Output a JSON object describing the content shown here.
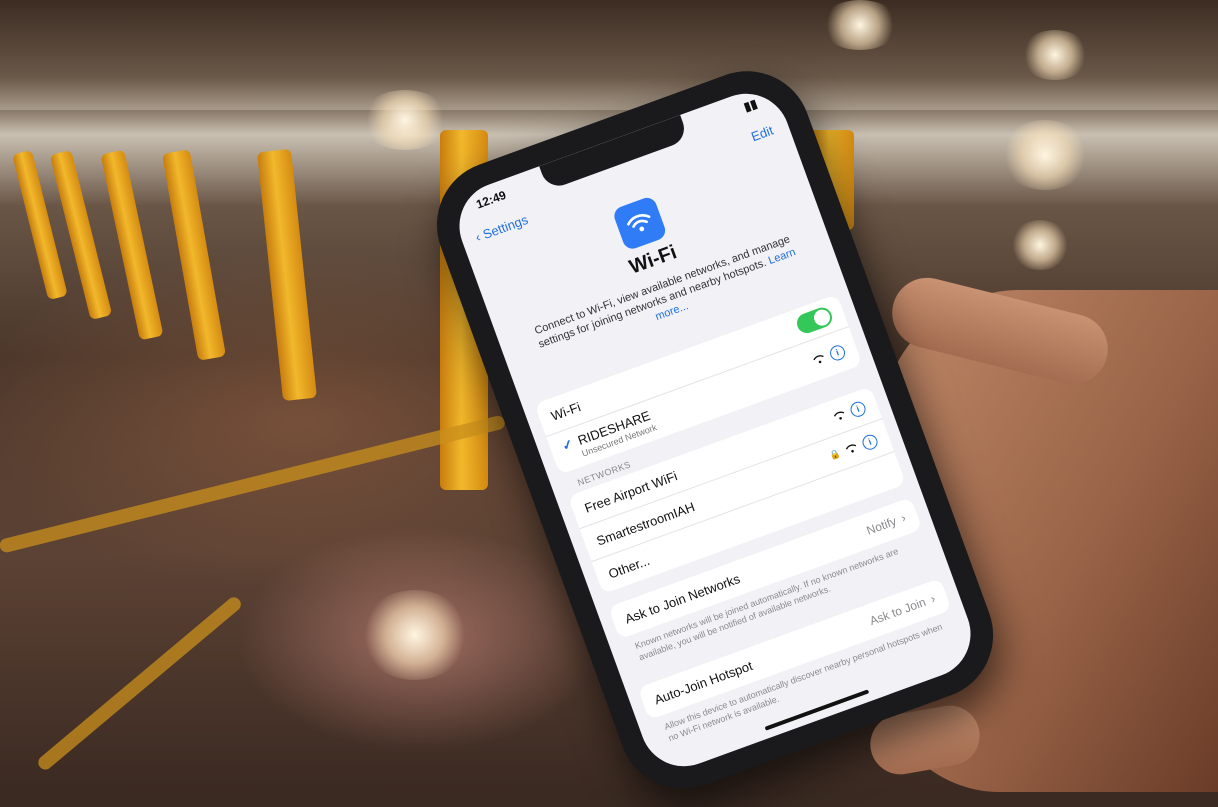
{
  "status_bar": {
    "time": "12:49"
  },
  "nav": {
    "back_label": "Settings",
    "edit_label": "Edit"
  },
  "header": {
    "title": "Wi-Fi",
    "description": "Connect to Wi-Fi, view available networks, and manage settings for joining networks and nearby hotspots.",
    "learn_more": "Learn more..."
  },
  "wifi_toggle": {
    "label": "Wi-Fi",
    "on": true
  },
  "connected": {
    "name": "RIDESHARE",
    "subtitle": "Unsecured Network"
  },
  "networks": {
    "section_label": "NETWORKS",
    "items": [
      {
        "name": "Free Airport WiFi",
        "locked": false
      },
      {
        "name": "SmartestroomIAH",
        "locked": true
      },
      {
        "name": "Other...",
        "locked": false
      }
    ]
  },
  "ask_to_join": {
    "label": "Ask to Join Networks",
    "value": "Notify",
    "footnote": "Known networks will be joined automatically. If no known networks are available, you will be notified of available networks."
  },
  "auto_join": {
    "label": "Auto-Join Hotspot",
    "value": "Ask to Join",
    "footnote": "Allow this device to automatically discover nearby personal hotspots when no Wi-Fi network is available."
  },
  "colors": {
    "accent": "#1f6fe0",
    "toggle_on": "#34c759",
    "pole": "#f2b82c"
  }
}
